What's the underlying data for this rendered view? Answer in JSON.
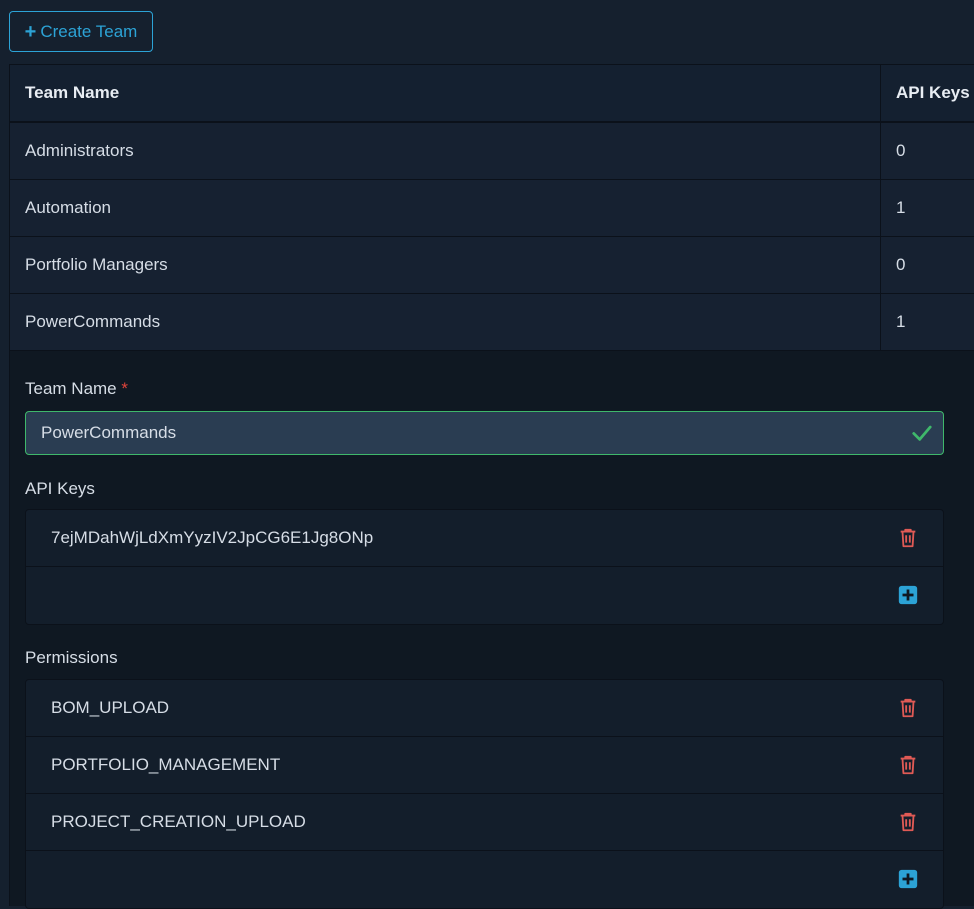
{
  "toolbar": {
    "create_team_label": "Create Team"
  },
  "table": {
    "headers": {
      "team_name": "Team Name",
      "api_keys": "API Keys"
    },
    "rows": [
      {
        "name": "Administrators",
        "api_keys": "0"
      },
      {
        "name": "Automation",
        "api_keys": "1"
      },
      {
        "name": "Portfolio Managers",
        "api_keys": "0"
      },
      {
        "name": "PowerCommands",
        "api_keys": "1"
      }
    ]
  },
  "detail": {
    "team_name_label": "Team Name",
    "required_marker": "*",
    "team_name_value": "PowerCommands",
    "api_keys_label": "API Keys",
    "api_keys": [
      "7ejMDahWjLdXmYyzIV2JpCG6E1Jg8ONp"
    ],
    "permissions_label": "Permissions",
    "permissions": [
      "BOM_UPLOAD",
      "PORTFOLIO_MANAGEMENT",
      "PROJECT_CREATION_UPLOAD"
    ]
  },
  "colors": {
    "accent": "#2ca3d6",
    "delete": "#e05a55",
    "valid": "#3fb86b",
    "required": "#e0443b"
  },
  "icons": {
    "create": "plus-icon",
    "delete": "trash-icon",
    "add": "plus-square-icon",
    "valid": "check-icon"
  }
}
